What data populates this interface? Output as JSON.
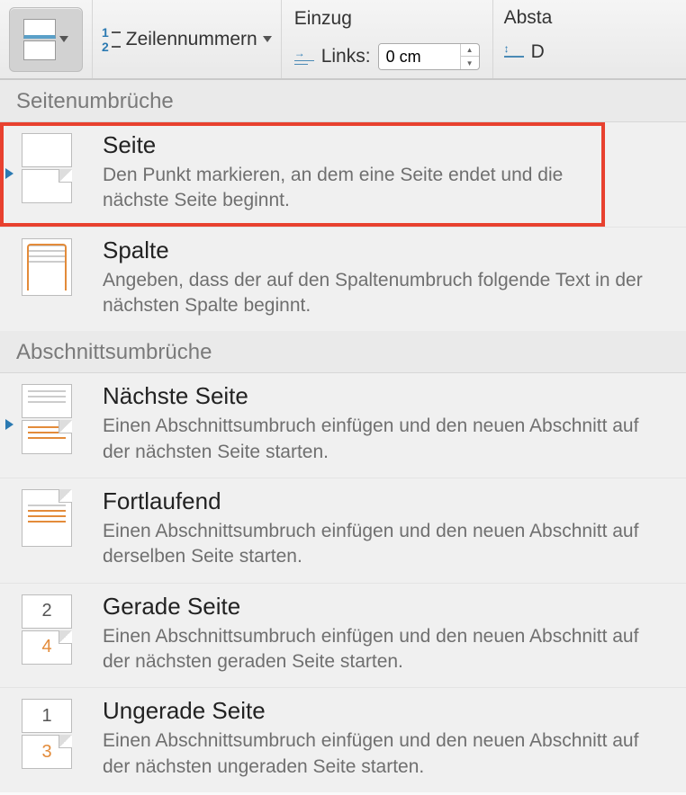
{
  "ribbon": {
    "line_numbers_label": "Zeilennummern",
    "indent": {
      "group_label": "Einzug",
      "left_label": "Links:",
      "left_value": "0 cm"
    },
    "spacing": {
      "group_label": "Absta",
      "right_fragment": "D"
    }
  },
  "sections": [
    {
      "header": "Seitenumbrüche",
      "items": [
        {
          "title": "Seite",
          "desc": "Den Punkt markieren, an dem eine Seite endet und die nächste Seite beginnt.",
          "highlighted": true,
          "selected_marker": true
        },
        {
          "title": "Spalte",
          "desc": "Angeben, dass der auf den Spaltenumbruch folgende Text in der nächsten Spalte beginnt."
        }
      ]
    },
    {
      "header": "Abschnittsumbrüche",
      "items": [
        {
          "title": "Nächste Seite",
          "desc": "Einen Abschnittsumbruch einfügen und den neuen Abschnitt auf der nächsten Seite starten.",
          "selected_marker": true
        },
        {
          "title": "Fortlaufend",
          "desc": "Einen Abschnittsumbruch einfügen und den neuen Abschnitt auf derselben Seite starten."
        },
        {
          "title": "Gerade Seite",
          "desc": "Einen Abschnittsumbruch einfügen und den neuen Abschnitt auf der nächsten geraden Seite starten.",
          "num_a": "2",
          "num_b": "4"
        },
        {
          "title": "Ungerade Seite",
          "desc": "Einen Abschnittsumbruch einfügen und den neuen Abschnitt auf der nächsten ungeraden Seite starten.",
          "num_a": "1",
          "num_b": "3"
        }
      ]
    }
  ]
}
